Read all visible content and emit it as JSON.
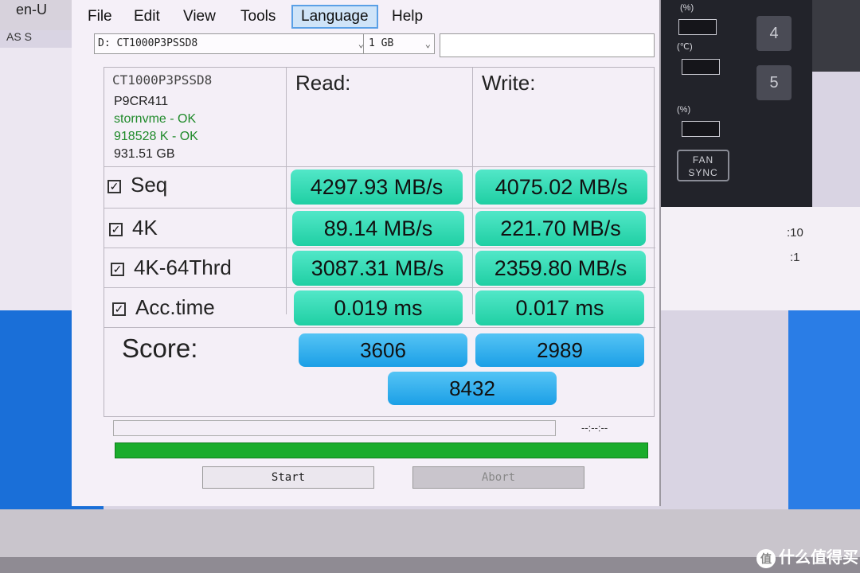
{
  "background": {
    "lang_tab": "en-U",
    "addr_text": "AS S",
    "fan_sync": "FAN SYNC",
    "right_labels": [
      "(%)",
      "(℃)",
      "(%)"
    ],
    "right_numbers": [
      "4",
      "5"
    ],
    "time_partial_1": ":10",
    "time_partial_2": ":1",
    "watermark": "什么值得买",
    "watermark_logo": "值"
  },
  "menubar": {
    "items": [
      "File",
      "Edit",
      "View",
      "Tools",
      "Language",
      "Help"
    ]
  },
  "toolbar": {
    "drive": "D: CT1000P3PSSD8",
    "size": "1 GB",
    "field_value": ""
  },
  "drive_info": {
    "model": "CT1000P3PSSD8",
    "firmware": "P9CR411",
    "driver": "stornvme - OK",
    "alignment": "918528 K - OK",
    "capacity": "931.51 GB"
  },
  "columns": {
    "read": "Read:",
    "write": "Write:"
  },
  "rows": [
    {
      "label": "Seq",
      "checked": true,
      "read": "4297.93 MB/s",
      "write": "4075.02 MB/s"
    },
    {
      "label": "4K",
      "checked": true,
      "read": "89.14 MB/s",
      "write": "221.70 MB/s"
    },
    {
      "label": "4K-64Thrd",
      "checked": true,
      "read": "3087.31 MB/s",
      "write": "2359.80 MB/s"
    },
    {
      "label": "Acc.time",
      "checked": true,
      "read": "0.019 ms",
      "write": "0.017 ms"
    }
  ],
  "score": {
    "label": "Score:",
    "read": "3606",
    "write": "2989",
    "total": "8432"
  },
  "status": {
    "time": "--:--:--",
    "progress_fraction": 1.0
  },
  "buttons": {
    "start": "Start",
    "abort": "Abort"
  },
  "colors": {
    "result_green": "#2fd9b0",
    "score_blue": "#33b3ef",
    "progress_green": "#1aac2c"
  }
}
